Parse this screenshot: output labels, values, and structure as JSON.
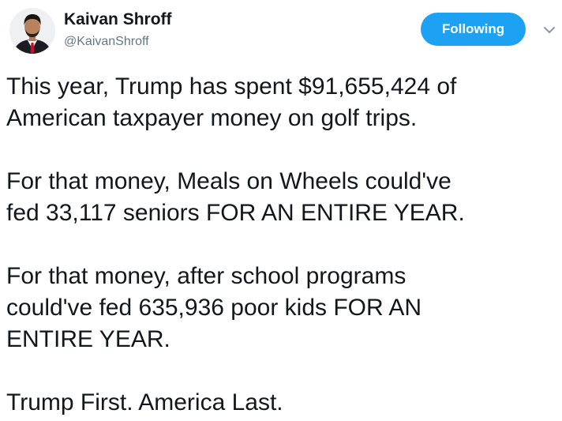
{
  "author": {
    "name": "Kaivan Shroff",
    "handle": "@KaivanShroff"
  },
  "follow_button": {
    "label": "Following",
    "color": "#1da1f2"
  },
  "menu": {
    "icon": "chevron-down-icon"
  },
  "tweet": {
    "paragraphs": [
      "This year, Trump has spent $91,655,424 of\nAmerican taxpayer money on golf trips.",
      "For that money, Meals on Wheels could've\nfed 33,117 seniors FOR AN ENTIRE YEAR.",
      "For that money, after school programs\ncould've fed 635,936 poor kids FOR AN\nENTIRE YEAR.",
      "Trump First. America Last."
    ]
  }
}
